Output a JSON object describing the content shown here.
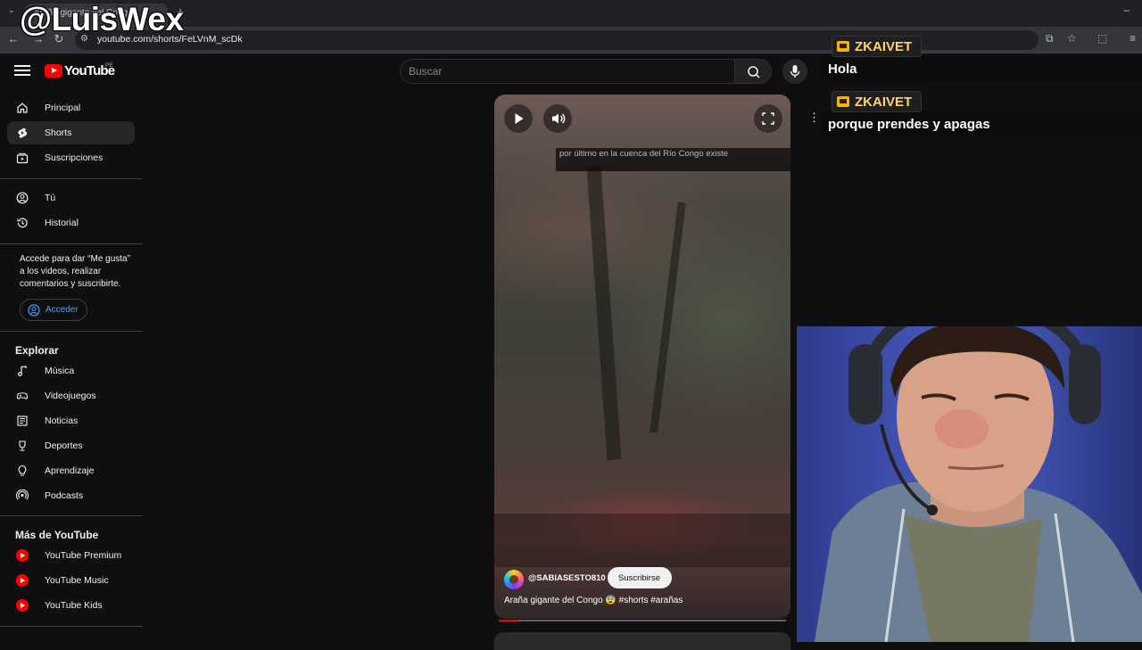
{
  "browser": {
    "tab_title": "Araña gigante del Congo",
    "url": "youtube.com/shorts/FeLVnM_scDk",
    "new_tab": "+",
    "minimize": "–"
  },
  "watermark": "@LuisWex",
  "header": {
    "logo_text": "YouTube",
    "country": "PE",
    "search_placeholder": "Buscar"
  },
  "sidebar": {
    "main_items": [
      {
        "label": "Principal",
        "icon": "home-icon"
      },
      {
        "label": "Shorts",
        "icon": "shorts-icon"
      },
      {
        "label": "Suscripciones",
        "icon": "subscriptions-icon"
      }
    ],
    "you_items": [
      {
        "label": "Tú",
        "icon": "account-icon"
      },
      {
        "label": "Historial",
        "icon": "history-icon"
      }
    ],
    "signin_prompt": "Accede para dar “Me gusta” a los videos, realizar comentarios y suscribirte.",
    "signin_button": "Acceder",
    "explore_heading": "Explorar",
    "explore_items": [
      {
        "label": "Música",
        "icon": "music-icon"
      },
      {
        "label": "Videojuegos",
        "icon": "gaming-icon"
      },
      {
        "label": "Noticias",
        "icon": "news-icon"
      },
      {
        "label": "Deportes",
        "icon": "trophy-icon"
      },
      {
        "label": "Aprendizaje",
        "icon": "lightbulb-icon"
      },
      {
        "label": "Podcasts",
        "icon": "podcast-icon"
      }
    ],
    "more_heading": "Más de YouTube",
    "more_items": [
      {
        "label": "YouTube Premium",
        "icon": "youtube-premium-icon"
      },
      {
        "label": "YouTube Music",
        "icon": "youtube-music-icon"
      },
      {
        "label": "YouTube Kids",
        "icon": "youtube-kids-icon"
      }
    ]
  },
  "short": {
    "caption": "por último en la cuenca del Río Congo existe",
    "channel": "@SABIASESTO810",
    "subscribe": "Suscribirse",
    "title": "Araña gigante del Congo 😨 #shorts #arañas",
    "progress": 0.07
  },
  "chat": [
    {
      "user": "ZKAIVET",
      "message": "Hola"
    },
    {
      "user": "ZKAIVET",
      "message": "porque prendes y apagas"
    }
  ],
  "colors": {
    "background": "#0f0f0f",
    "brand_red": "#ff0000",
    "link_blue": "#3ea6ff",
    "chat_name": "#ffd36b"
  }
}
